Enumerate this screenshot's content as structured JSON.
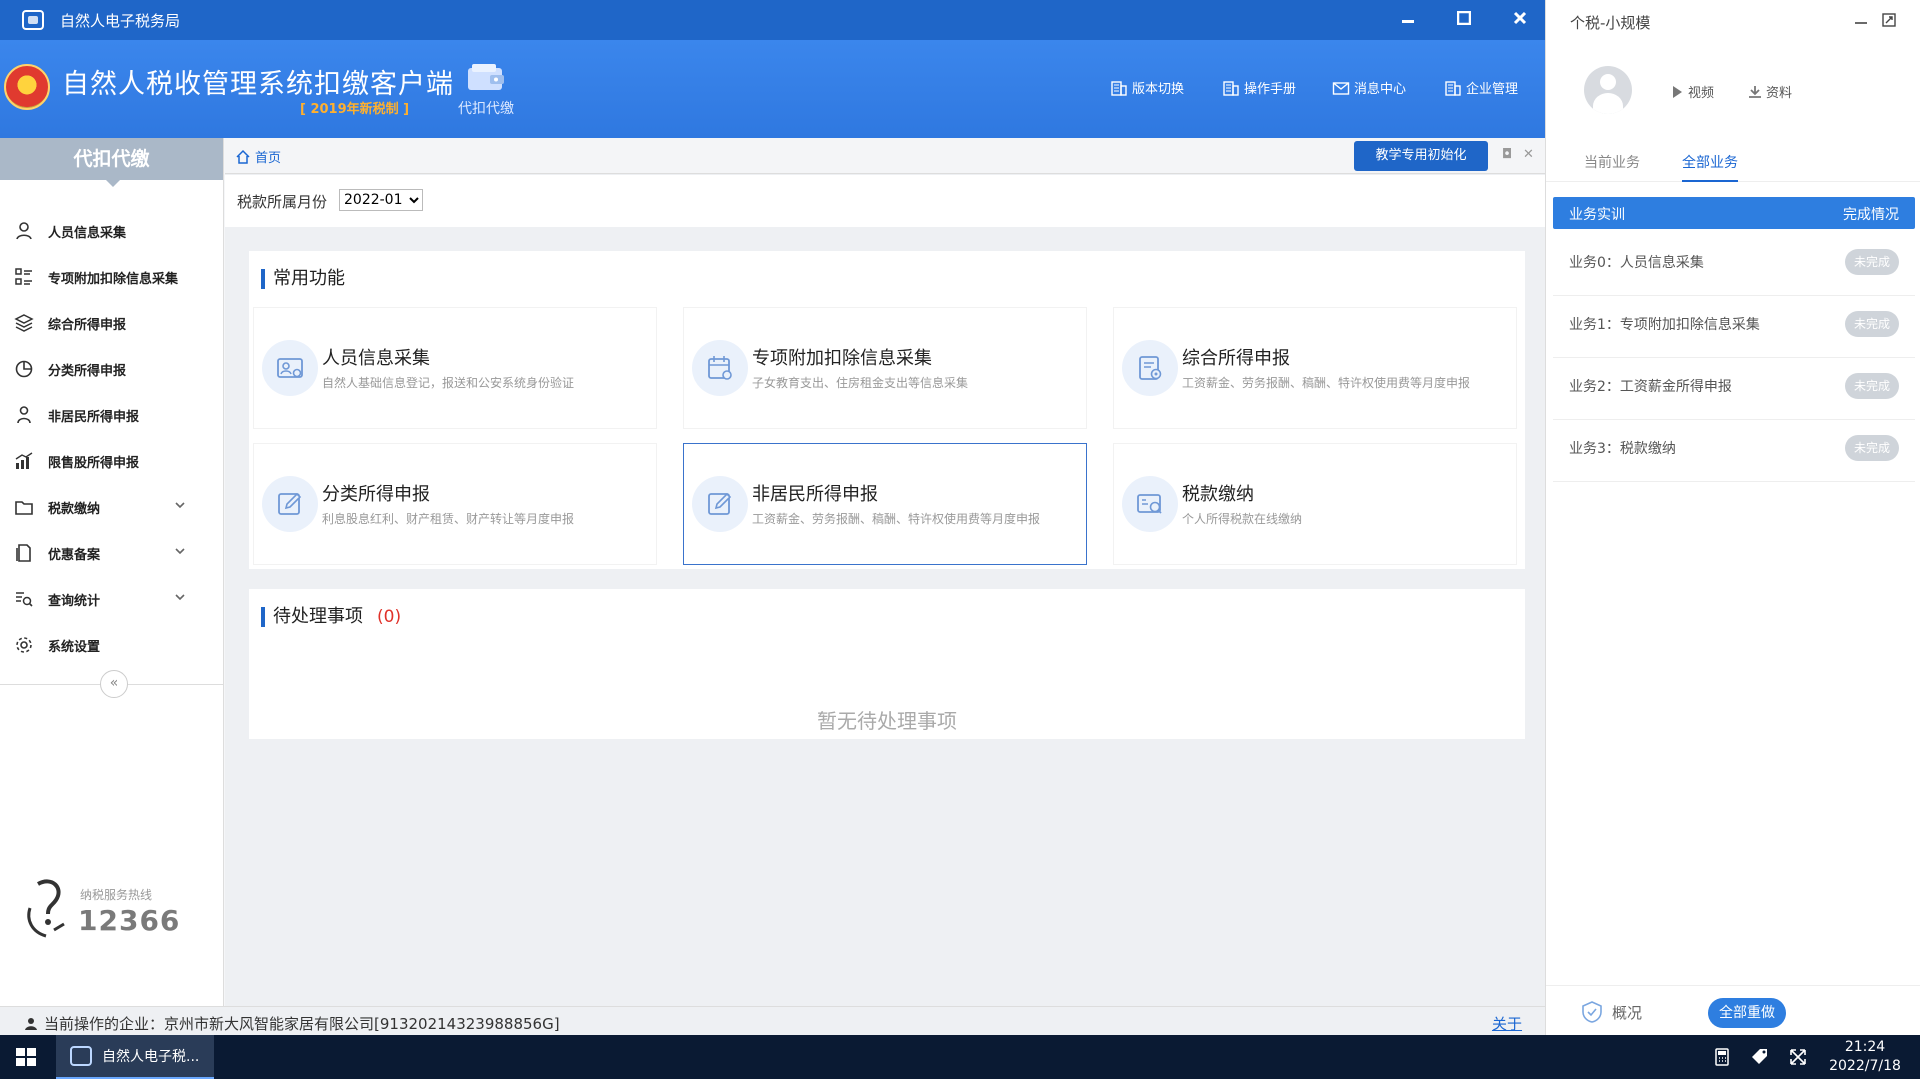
{
  "window": {
    "title": "自然人电子税务局"
  },
  "header": {
    "system_name": "自然人税收管理系统扣缴客户端",
    "version_tag": "[ 2019年新税制 ]",
    "module": "代扣代缴",
    "nav": [
      {
        "label": "版本切换",
        "icon": "building-icon"
      },
      {
        "label": "操作手册",
        "icon": "book-icon"
      },
      {
        "label": "消息中心",
        "icon": "mail-icon"
      },
      {
        "label": "企业管理",
        "icon": "building-icon"
      }
    ]
  },
  "sidebar": {
    "title": "代扣代缴",
    "items": [
      {
        "label": "人员信息采集",
        "icon": "user-icon",
        "expandable": false
      },
      {
        "label": "专项附加扣除信息采集",
        "icon": "grid-list-icon",
        "expandable": false
      },
      {
        "label": "综合所得申报",
        "icon": "layers-icon",
        "expandable": false
      },
      {
        "label": "分类所得申报",
        "icon": "pie-chart-icon",
        "expandable": false
      },
      {
        "label": "非居民所得申报",
        "icon": "person-icon",
        "expandable": false
      },
      {
        "label": "限售股所得申报",
        "icon": "bar-chart-icon",
        "expandable": false
      },
      {
        "label": "税款缴纳",
        "icon": "folder-icon",
        "expandable": true
      },
      {
        "label": "优惠备案",
        "icon": "document-icon",
        "expandable": true
      },
      {
        "label": "查询统计",
        "icon": "search-list-icon",
        "expandable": true
      },
      {
        "label": "系统设置",
        "icon": "gear-icon",
        "expandable": false
      }
    ],
    "collapse_label": "«",
    "hotline": {
      "label": "纳税服务热线",
      "number": "12366"
    }
  },
  "tabbar": {
    "home_label": "首页",
    "init_button": "教学专用初始化",
    "maximize": "◘",
    "close": "✕"
  },
  "period": {
    "label": "税款所属月份",
    "value": "2022-01"
  },
  "common": {
    "title": "常用功能",
    "cards": [
      {
        "name": "人员信息采集",
        "desc": "自然人基础信息登记，报送和公安系统身份验证",
        "icon": "id-card-icon"
      },
      {
        "name": "专项附加扣除信息采集",
        "desc": "子女教育支出、住房租金支出等信息采集",
        "icon": "calendar-check-icon"
      },
      {
        "name": "综合所得申报",
        "desc": "工资薪金、劳务报酬、稿酬、特许权使用费等月度申报",
        "icon": "report-icon"
      },
      {
        "name": "分类所得申报",
        "desc": "利息股息红利、财产租赁、财产转让等月度申报",
        "icon": "edit-icon"
      },
      {
        "name": "非居民所得申报",
        "desc": "工资薪金、劳务报酬、稿酬、特许权使用费等月度申报",
        "icon": "edit-icon"
      },
      {
        "name": "税款缴纳",
        "desc": "个人所得税款在线缴纳",
        "icon": "payment-icon"
      }
    ]
  },
  "pending": {
    "title": "待处理事项",
    "count": "(0)",
    "empty": "暂无待处理事项"
  },
  "status": {
    "company": "当前操作的企业：京州市新大风智能家居有限公司[91320214323988856G]",
    "about": "关于"
  },
  "panel": {
    "title": "个税-小规模",
    "links": [
      {
        "label": "视频"
      },
      {
        "label": "资料"
      }
    ],
    "tabs": [
      {
        "label": "当前业务"
      },
      {
        "label": "全部业务"
      }
    ],
    "header_left": "业务实训",
    "header_right": "完成情况",
    "tasks": [
      {
        "name": "业务0：人员信息采集",
        "status": "未完成"
      },
      {
        "name": "业务1：专项附加扣除信息采集",
        "status": "未完成"
      },
      {
        "name": "业务2：工资薪金所得申报",
        "status": "未完成"
      },
      {
        "name": "业务3：税款缴纳",
        "status": "未完成"
      }
    ],
    "overview": "概况",
    "redo_all": "全部重做"
  },
  "taskbar": {
    "app_label": "自然人电子税...",
    "time": "21:24",
    "date": "2022/7/18"
  },
  "colors": {
    "primary": "#1f66c8",
    "header": "#3b86ec",
    "accent": "#2e7ee0",
    "danger": "#e0322a",
    "warning": "#ffb02e"
  }
}
